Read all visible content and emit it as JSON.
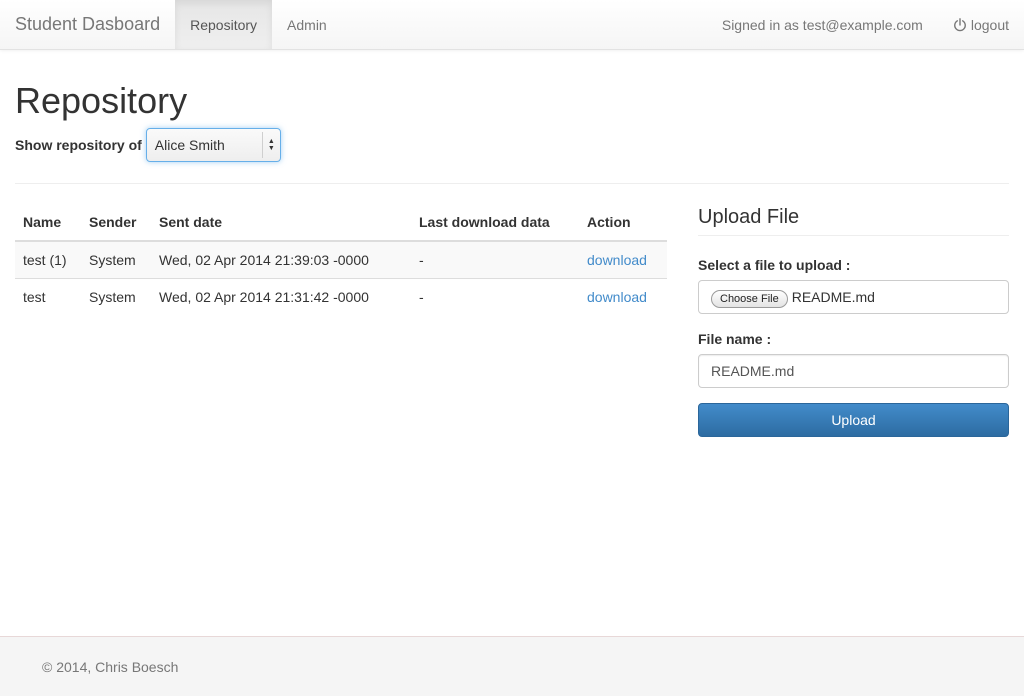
{
  "navbar": {
    "brand": "Student Dasboard",
    "tabs": [
      {
        "label": "Repository",
        "active": true
      },
      {
        "label": "Admin",
        "active": false
      }
    ],
    "signed_in_text": "Signed in as test@example.com",
    "logout_label": "logout",
    "logout_icon": "power-icon"
  },
  "main": {
    "title": "Repository",
    "show_repo_label": "Show repository of",
    "selected_student": "Alice Smith",
    "table": {
      "headers": [
        "Name",
        "Sender",
        "Sent date",
        "Last download data",
        "Action"
      ],
      "rows": [
        {
          "name": "test (1)",
          "sender": "System",
          "sent_date": "Wed, 02 Apr 2014 21:39:03 -0000",
          "last_download": "-",
          "action": "download"
        },
        {
          "name": "test",
          "sender": "System",
          "sent_date": "Wed, 02 Apr 2014 21:31:42 -0000",
          "last_download": "-",
          "action": "download"
        }
      ]
    }
  },
  "upload": {
    "title": "Upload File",
    "select_label": "Select a file to upload :",
    "choose_button": "Choose File",
    "chosen_file": "README.md",
    "file_name_label": "File name :",
    "file_name_value": "README.md",
    "submit_label": "Upload"
  },
  "footer": {
    "text": "© 2014, Chris Boesch"
  },
  "colors": {
    "link": "#428bca",
    "primary_button": "#3071a9",
    "muted_text": "#777777"
  }
}
